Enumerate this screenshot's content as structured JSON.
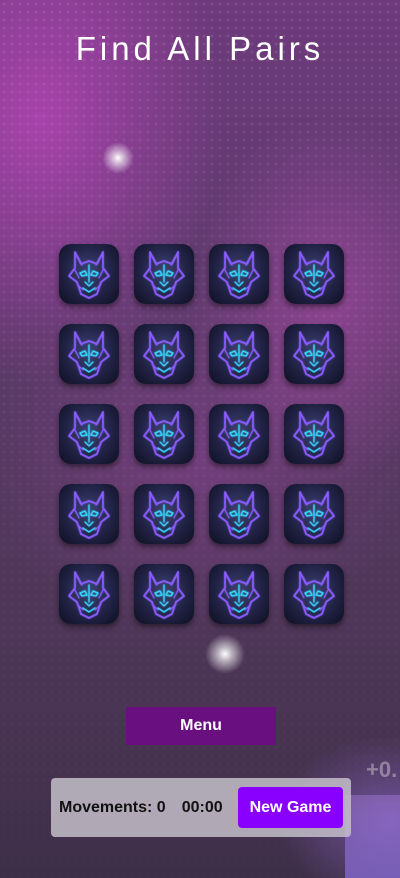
{
  "title": "Find All Pairs",
  "card_back_icon": "wolf-icon",
  "cards": [
    {
      "state": "face-down"
    },
    {
      "state": "face-down"
    },
    {
      "state": "face-down"
    },
    {
      "state": "face-down"
    },
    {
      "state": "face-down"
    },
    {
      "state": "face-down"
    },
    {
      "state": "face-down"
    },
    {
      "state": "face-down"
    },
    {
      "state": "face-down"
    },
    {
      "state": "face-down"
    },
    {
      "state": "face-down"
    },
    {
      "state": "face-down"
    },
    {
      "state": "face-down"
    },
    {
      "state": "face-down"
    },
    {
      "state": "face-down"
    },
    {
      "state": "face-down"
    },
    {
      "state": "face-down"
    },
    {
      "state": "face-down"
    },
    {
      "state": "face-down"
    },
    {
      "state": "face-down"
    }
  ],
  "menu_label": "Menu",
  "status": {
    "movements": "Movements: 0",
    "timer": "00:00",
    "new_game_label": "New Game"
  },
  "background_text": "+0.",
  "colors": {
    "accent": "#8a00ff",
    "menu": "#6a0f80",
    "wolf_outline": "#8a5cff",
    "wolf_glow": "#35d6ff"
  }
}
